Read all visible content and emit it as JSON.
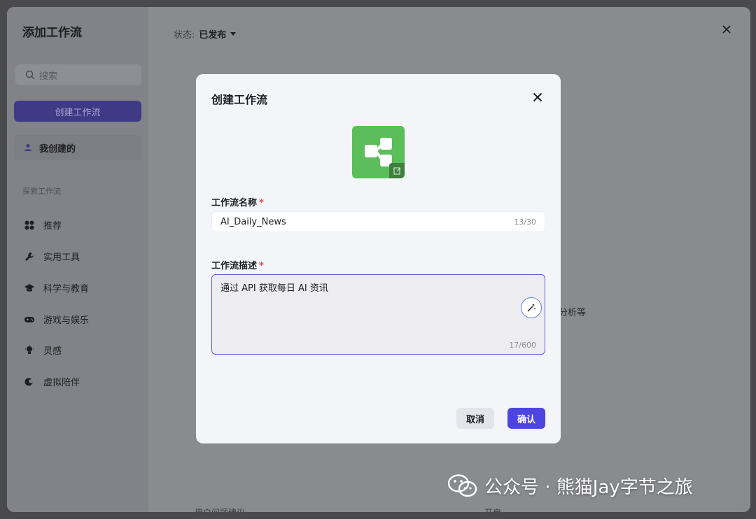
{
  "outer": {
    "title": "添加工作流",
    "search_placeholder": "搜索",
    "create_button": "创建工作流",
    "mine_label": "我创建的",
    "explore_label": "探索工作流",
    "sidebar_items": [
      {
        "label": "推荐",
        "icon": "grid-icon"
      },
      {
        "label": "实用工具",
        "icon": "wrench-icon"
      },
      {
        "label": "科学与教育",
        "icon": "graduation-cap-icon"
      },
      {
        "label": "游戏与娱乐",
        "icon": "gamepad-icon"
      },
      {
        "label": "灵感",
        "icon": "lightbulb-icon"
      },
      {
        "label": "虚拟陪伴",
        "icon": "heart-chat-icon"
      }
    ],
    "status_label": "状态:",
    "status_value": "已发布",
    "bg_text": "分析等",
    "bg_bottom_left": "用户问题建议",
    "bg_bottom_right": "开启"
  },
  "modal": {
    "title": "创建工作流",
    "name_label": "工作流名称",
    "name_value": "AI_Daily_News",
    "name_count": "13/30",
    "desc_label": "工作流描述",
    "desc_value": "通过 API 获取每日 AI 资讯",
    "desc_count": "17/600",
    "required_mark": "*",
    "cancel_label": "取消",
    "confirm_label": "确认",
    "icon_color": "#5bbe5b",
    "accent_color": "#4d45e0"
  },
  "watermark": {
    "text": "公众号 · 熊猫Jay字节之旅"
  }
}
